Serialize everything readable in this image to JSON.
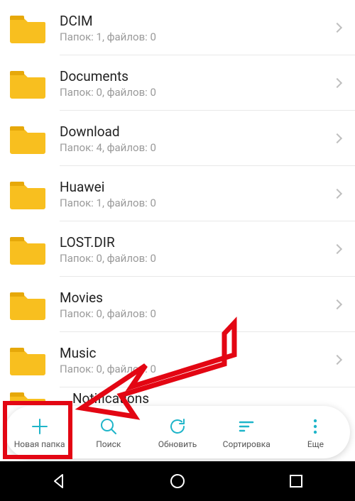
{
  "folders": [
    {
      "name": "DCIM",
      "sub": "Папок: 1, файлов: 0"
    },
    {
      "name": "Documents",
      "sub": "Папок: 0, файлов: 0"
    },
    {
      "name": "Download",
      "sub": "Папок: 4, файлов: 0"
    },
    {
      "name": "Huawei",
      "sub": "Папок: 1, файлов: 0"
    },
    {
      "name": "LOST.DIR",
      "sub": "Папок: 0, файлов: 0"
    },
    {
      "name": "Movies",
      "sub": "Папок: 0, файлов: 0"
    },
    {
      "name": "Music",
      "sub": "Папок: 0, файлов: 0"
    }
  ],
  "partial_folder": {
    "name": "Notifications"
  },
  "toolbar": {
    "new_folder": "Новая папка",
    "search": "Поиск",
    "refresh": "Обновить",
    "sort": "Сортировка",
    "more": "Еще"
  },
  "colors": {
    "accent": "#1fb5c9",
    "folder": "#f8bf1f",
    "folder_tab": "#e6a80a"
  }
}
